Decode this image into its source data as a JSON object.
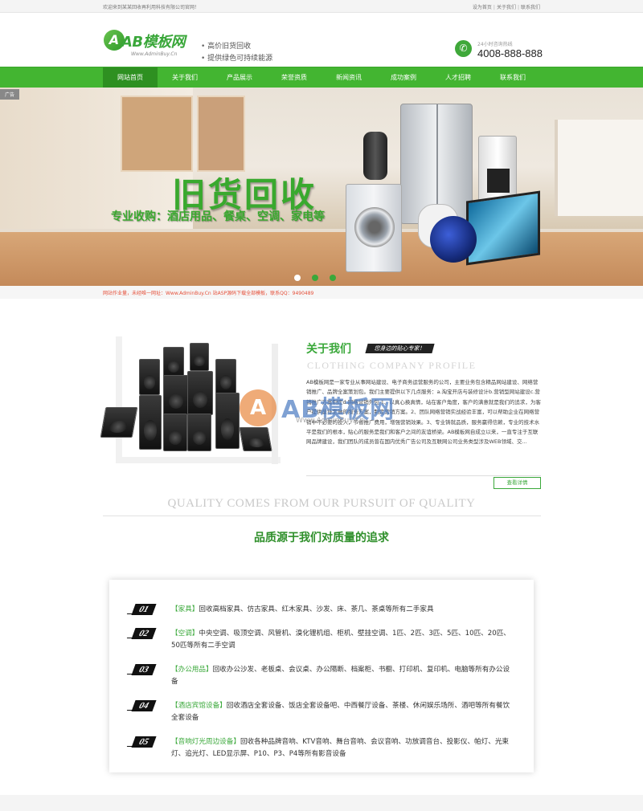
{
  "topbar": {
    "welcome": "欢迎来到某某回收再利用科技有限公司官网！",
    "links": [
      "设为首页",
      "关于我们",
      "联系我们"
    ]
  },
  "header": {
    "logo_mark": "A",
    "logo_name": "AB模板网",
    "logo_url": "Www.AdminBuy.Cn",
    "slogans": [
      "高价旧货回收",
      "提供绿色可持续能源"
    ],
    "phone_label": "24小时咨询热线",
    "phone": "4008-888-888"
  },
  "nav": {
    "items": [
      "网站首页",
      "关于我们",
      "产品展示",
      "荣誉资质",
      "新闻资讯",
      "成功案例",
      "人才招聘",
      "联系我们"
    ],
    "active_index": 0
  },
  "banner": {
    "tag": "广告",
    "title": "旧货回收",
    "subtitle": "专业收购：酒店用品、餐桌、空调、家电等",
    "slide_count": 3,
    "active_slide": 0
  },
  "notice": "网站作业量，未经唯一网址：Www.AdminBuy.Cn 站ASP源码下载全部模板，联系QQ：9490489",
  "about": {
    "title": "关于我们",
    "badge": "您身边的贴心专家！",
    "profile_en": "CLOTHING COMPANY PROFILE",
    "description": "AB模板网是一家专业从事网站建设、电子商务运营服务的公司，主要业务包含精品网站建设、网络营销推广、品牌全案策划包。我们主要提供以下几点服务：a.淘宝开店与装修设计b.营销型网站建设c.营销推广方案制定d.网络营销外包 1、以真心换真情，站在客户角度，客户的满意就是我们的追求，为客户提供量身定做的服务方案，制定营销方案。2、团队网络营销实战经验丰富，可以帮助企业在网络营销中不必要的投入，节省推广费用，增强营销效果。3、专业铸就品质，服务赢得信赖，专业的技术水平是我们的根本，贴心的服务是我们和客户之间的友谊桥梁。AB模板网自成立以来，一直专注于互联网品牌建设，我们团队的成员曾在国内优秀广告公司及互联网公司业务类型涉及WEB领域、交...",
    "more": "查看详情",
    "watermark_mark": "A",
    "watermark_text": "AB模板网",
    "watermark_url": "Www.AdminBuy.Cn"
  },
  "quality": {
    "title_en": "QUALITY COMES FROM OUR PURSUIT OF QUALITY",
    "title_cn": "品质源于我们对质量的追求",
    "items": [
      {
        "num": "01",
        "category": "【家具】",
        "text": "回收高档家具、仿古家具、红木家具、沙发、床、茶几、茶桌等所有二手家具"
      },
      {
        "num": "02",
        "category": "【空调】",
        "text": "中央空调、吸顶空调、风管机、溴化锂机组、柜机、壁挂空调、1匹、2匹、3匹、5匹、10匹、20匹、50匹等所有二手空调"
      },
      {
        "num": "03",
        "category": "【办公用品】",
        "text": "回收办公沙发、老板桌、会议桌、办公隔断、档案柜、书橱、打印机、复印机、电脑等所有办公设备"
      },
      {
        "num": "04",
        "category": "【酒店宾馆设备】",
        "text": "回收酒店全套设备、饭店全套设备吧、中西餐厅设备、茶楼、休闲娱乐场所、酒吧等所有餐饮全套设备"
      },
      {
        "num": "05",
        "category": "【音响灯光周边设备】",
        "text": "回收各种品牌音响、KTV音响、舞台音响、会议音响、功放调音台、投影仪、帕灯、光束灯、追光灯、LED显示屏、P10、P3、P4等所有影音设备"
      }
    ]
  },
  "colors": {
    "brand": "#43b531",
    "brand_dark": "#2e9021",
    "notice": "#e5503a"
  }
}
